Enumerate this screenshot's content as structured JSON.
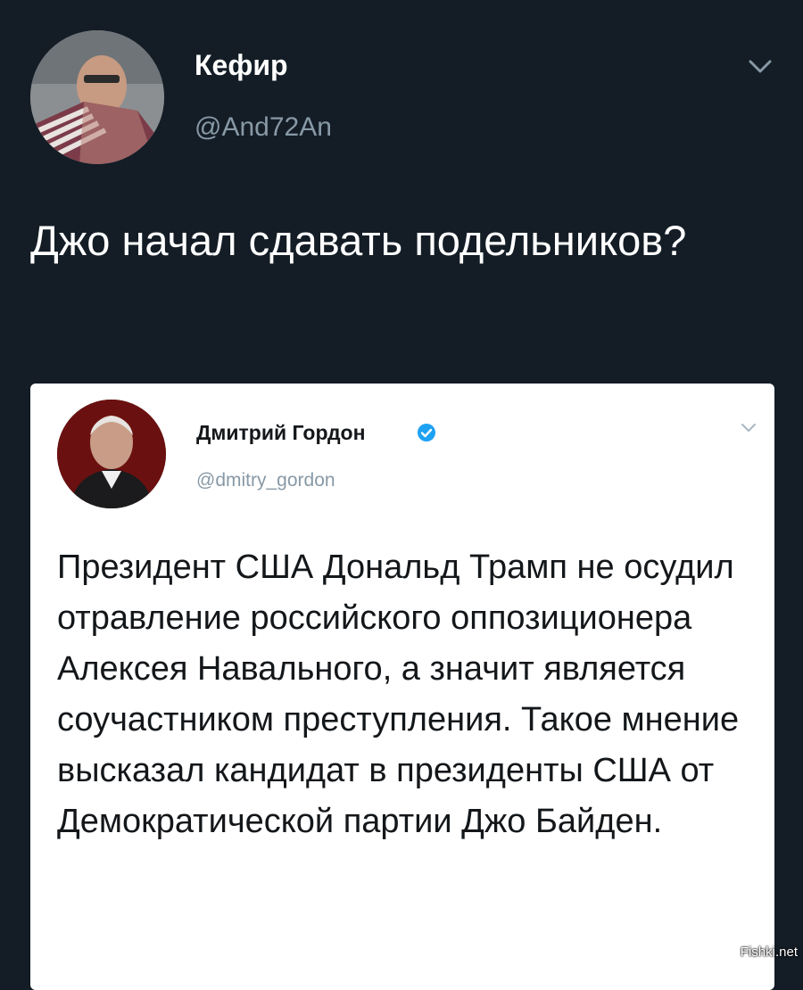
{
  "tweet": {
    "author_name": "Кефир",
    "author_handle": "@And72An",
    "text": "Джо начал сдавать подельников?"
  },
  "quoted_tweet": {
    "author_name": "Дмитрий Гордон",
    "author_handle": "@dmitry_gordon",
    "verified": true,
    "text": "Президент США Дональд Трамп не осудил отравление российского оппозиционера Алексея Навального, а значит является соучастником преступления. Такое мнение высказал кандидат в президенты США от Демократической партии Джо Байден."
  },
  "watermark": "Fishki.net",
  "colors": {
    "background": "#141d26",
    "card": "#ffffff",
    "secondary_text": "#8899a6",
    "verified_blue": "#1da1f2"
  },
  "icons": {
    "menu": "chevron-down-icon",
    "verified": "verified-badge-icon"
  }
}
